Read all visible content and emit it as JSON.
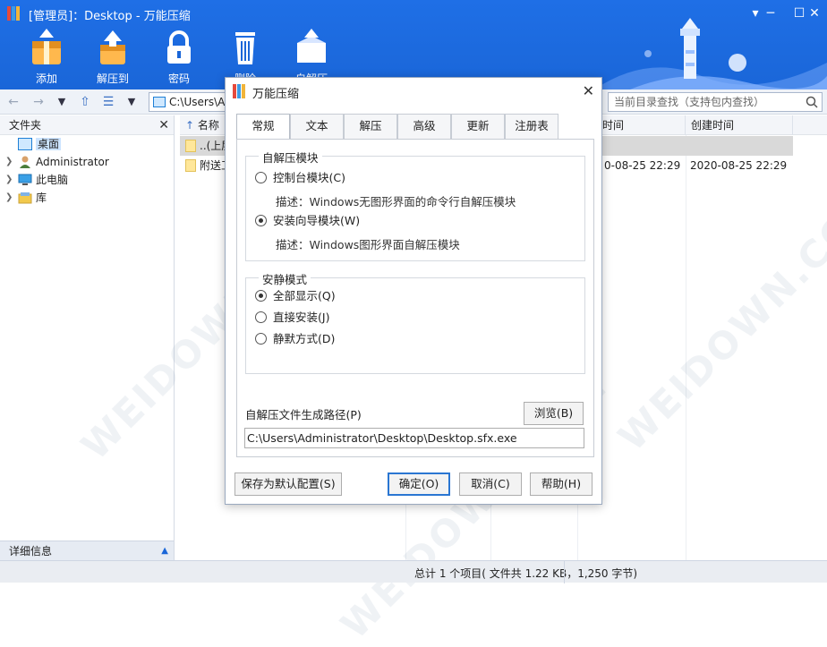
{
  "window": {
    "title": "[管理员]：Desktop - 万能压缩"
  },
  "toolbar": [
    {
      "label": "添加",
      "icon": "archive-add-icon"
    },
    {
      "label": "解压到",
      "icon": "extract-icon"
    },
    {
      "label": "密码",
      "icon": "lock-icon"
    },
    {
      "label": "删除",
      "icon": "trash-icon"
    },
    {
      "label": "自解压",
      "icon": "sfx-icon"
    }
  ],
  "nav": {
    "address": "C:\\Users\\A",
    "search_placeholder": "当前目录查找（支持包内查找）"
  },
  "left_panel": {
    "title": "文件夹",
    "items": [
      {
        "label": "桌面",
        "icon": "desktop-icon"
      },
      {
        "label": "Administrator",
        "icon": "user-icon"
      },
      {
        "label": "此电脑",
        "icon": "computer-icon"
      },
      {
        "label": "库",
        "icon": "library-icon"
      }
    ],
    "detail_label": "详细信息"
  },
  "file_list": {
    "columns": [
      "名称",
      "时间",
      "创建时间"
    ],
    "rows": [
      {
        "name": "..(上层",
        "modified": "",
        "created": ""
      },
      {
        "name": "附送工",
        "modified": "0-08-25 22:29",
        "created": "2020-08-25 22:29"
      }
    ]
  },
  "status": {
    "text": "总计 1 个项目( 文件共 1.22 KB，1,250 字节)"
  },
  "watermark": "WEIDOWN.COM",
  "dialog": {
    "title": "万能压缩",
    "tabs": [
      "常规",
      "文本",
      "解压",
      "高级",
      "更新",
      "注册表"
    ],
    "active_tab": "常规",
    "module_group": {
      "title": "自解压模块",
      "options": [
        {
          "label": "控制台模块(C)",
          "desc": "描述：Windows无图形界面的命令行自解压模块",
          "selected": false
        },
        {
          "label": "安装向导模块(W)",
          "desc": "描述：Windows图形界面自解压模块",
          "selected": true
        }
      ]
    },
    "silent_group": {
      "title": "安静模式",
      "options": [
        {
          "label": "全部显示(Q)",
          "selected": true
        },
        {
          "label": "直接安装(J)",
          "selected": false
        },
        {
          "label": "静默方式(D)",
          "selected": false
        }
      ]
    },
    "path_label": "自解压文件生成路径(P)",
    "browse_label": "浏览(B)",
    "path_value": "C:\\Users\\Administrator\\Desktop\\Desktop.sfx.exe",
    "save_default_label": "保存为默认配置(S)",
    "ok_label": "确定(O)",
    "cancel_label": "取消(C)",
    "help_label": "帮助(H)"
  },
  "colors": {
    "header_blue": "#1a66d8",
    "selection": "#cce4ff",
    "default_button_border": "#2a76d2"
  }
}
